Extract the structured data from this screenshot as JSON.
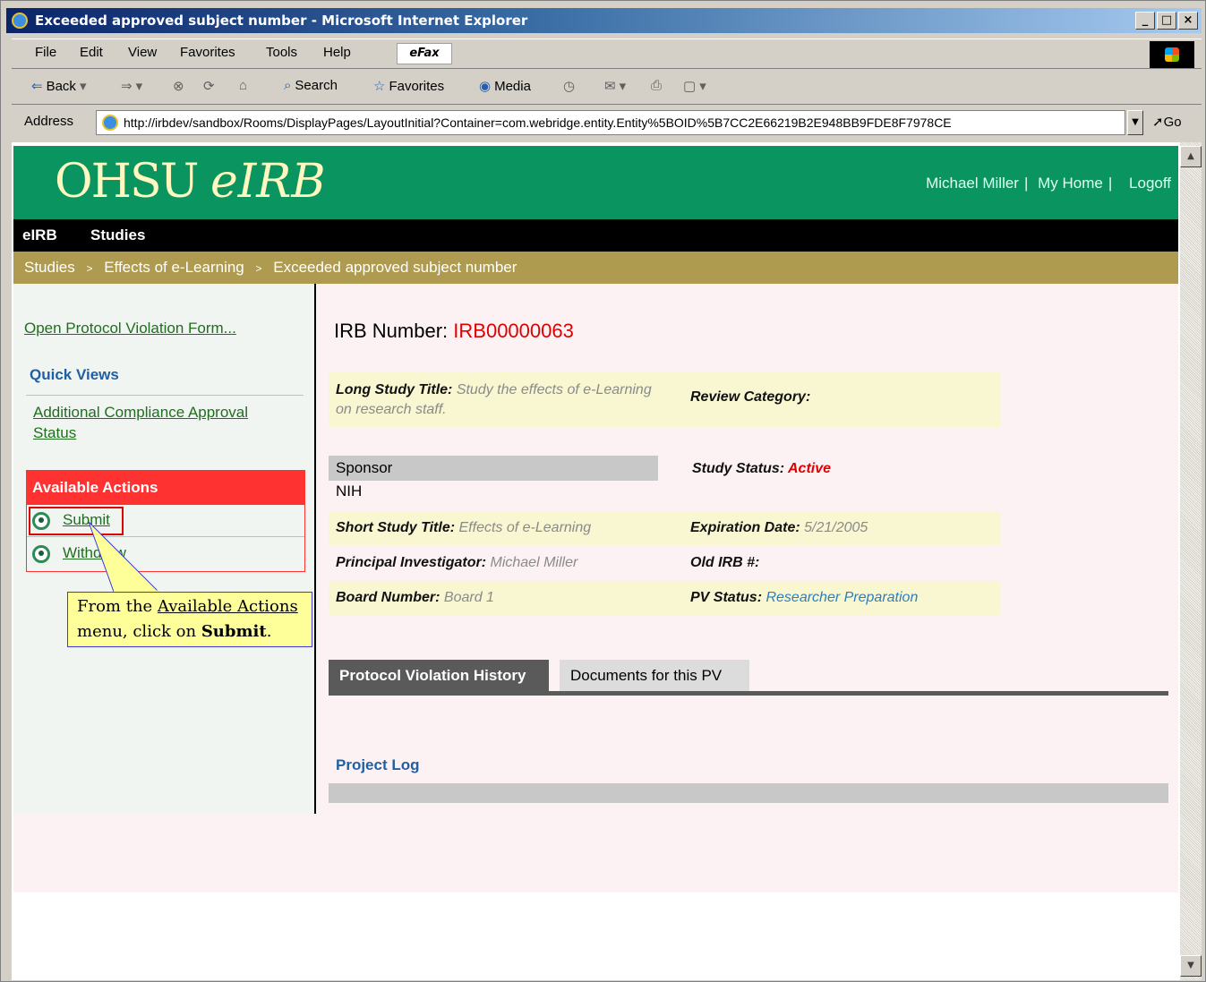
{
  "window": {
    "title": "Exceeded approved subject number - Microsoft Internet Explorer",
    "controls": {
      "minimize": "_",
      "maximize": "□",
      "close": "×"
    }
  },
  "menu": {
    "items": [
      "File",
      "Edit",
      "View",
      "Favorites",
      "Tools",
      "Help"
    ],
    "efax": "eFax"
  },
  "toolbar": {
    "back": "Back",
    "search": "Search",
    "favorites": "Favorites",
    "media": "Media"
  },
  "address": {
    "label": "Address",
    "url": "http://irbdev/sandbox/Rooms/DisplayPages/LayoutInitial?Container=com.webridge.entity.Entity%5BOID%5B7CC2E66219B2E948BB9FDE8F7978CE",
    "go": "Go"
  },
  "header": {
    "logo_main": "OHSU",
    "logo_italic": "eIRB",
    "user": "Michael Miller",
    "my_home": "My Home",
    "logoff": "Logoff",
    "sep": "|"
  },
  "nav": {
    "items": [
      "eIRB",
      "Studies"
    ]
  },
  "breadcrumb": {
    "items": [
      "Studies",
      "Effects of e-Learning",
      "Exceeded approved subject number"
    ],
    "sep": ">"
  },
  "sidebar": {
    "open_form": "Open Protocol Violation Form...",
    "quick_views_title": "Quick Views",
    "quick_views_item": "Additional Compliance Approval Status",
    "available_actions_title": "Available Actions",
    "actions": [
      "Submit",
      "Withdraw"
    ]
  },
  "callout": {
    "text1": "From the ",
    "link": "Available Actions",
    "text2": "menu, click on ",
    "bold": "Submit",
    "end": "."
  },
  "main": {
    "irb_label": "IRB Number:",
    "irb_number": "IRB00000063",
    "long_title_label": "Long Study Title:",
    "long_title_value": "Study the effects of e-Learning on research staff.",
    "review_category_label": "Review Category:",
    "sponsor_header": "Sponsor",
    "sponsor_value": "NIH",
    "study_status_label": "Study Status:",
    "study_status_value": "Active",
    "short_title_label": "Short Study Title:",
    "short_title_value": "Effects of e-Learning",
    "expiration_label": "Expiration Date:",
    "expiration_value": "5/21/2005",
    "pi_label": "Principal Investigator:",
    "pi_value": "Michael  Miller",
    "old_irb_label": "Old IRB #:",
    "board_label": "Board Number:",
    "board_value": "Board 1",
    "pv_status_label": "PV Status:",
    "pv_status_value": "Researcher Preparation",
    "tabs": [
      "Protocol Violation History",
      "Documents for this PV"
    ],
    "project_log": "Project Log"
  },
  "colors": {
    "header_green": "#0a9460",
    "crumb_gold": "#ae9b4f",
    "action_red": "#ff3232",
    "irb_red": "#e00000",
    "link_blue": "#2a7fc2"
  }
}
